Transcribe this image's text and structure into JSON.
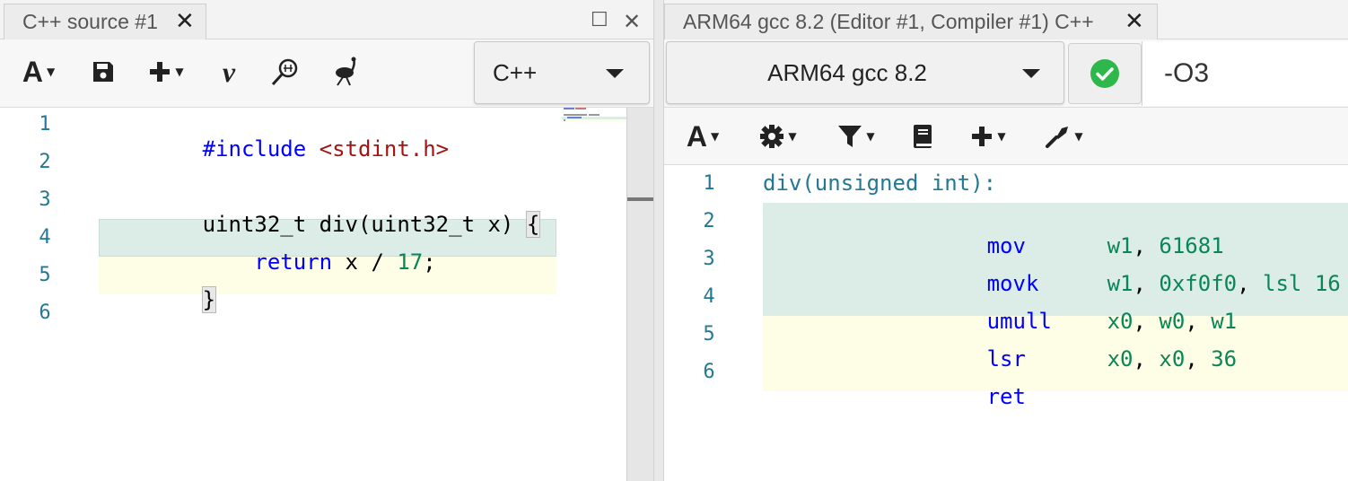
{
  "left_pane": {
    "tab_title": "C++ source #1",
    "language": "C++",
    "toolbar_icons": [
      "font-size-icon",
      "save-icon",
      "add-icon",
      "vim-icon",
      "search-icon",
      "ostrich-icon"
    ],
    "line_numbers": [
      "1",
      "2",
      "3",
      "4",
      "5",
      "6"
    ],
    "code": {
      "line1_directive": "#include",
      "line1_header": "<stdint.h>",
      "line3_text": "uint32_t div(uint32_t x) ",
      "line3_brace": "{",
      "line4_keyword": "return",
      "line4_expr": " x / ",
      "line4_number": "17",
      "line4_semicolon": ";",
      "line5_brace": "}"
    }
  },
  "right_pane": {
    "tab_title": "ARM64 gcc 8.2 (Editor #1, Compiler #1) C++",
    "compiler_name": "ARM64 gcc 8.2",
    "compiler_flags": "-O3",
    "status": "compiled-ok",
    "toolbar_icons": [
      "font-size-icon",
      "settings-icon",
      "filter-icon",
      "book-icon",
      "add-icon",
      "tools-icon"
    ],
    "line_numbers": [
      "1",
      "2",
      "3",
      "4",
      "5",
      "6"
    ],
    "asm": {
      "label": "div(unsigned int):",
      "l2_mn": "mov",
      "l2_op1": "w1",
      "l2_sep": ", ",
      "l2_op2": "61681",
      "l3_mn": "movk",
      "l3_op1": "w1",
      "l3_sep1": ", ",
      "l3_op2": "0xf0f0",
      "l3_sep2": ", ",
      "l3_op3": "lsl",
      "l3_sp": " ",
      "l3_op4": "16",
      "l4_mn": "umull",
      "l4_op1": "x0",
      "l4_sep1": ", ",
      "l4_op2": "w0",
      "l4_sep2": ", ",
      "l4_op3": "w1",
      "l5_mn": "lsr",
      "l5_op1": "x0",
      "l5_sep1": ", ",
      "l5_op2": "x0",
      "l5_sep2": ", ",
      "l5_op3": "36",
      "l6_mn": "ret"
    }
  },
  "colors": {
    "highlight_green": "#dcede8",
    "highlight_yellow": "#fefde5",
    "keyword_blue": "#0000ff",
    "string_red": "#a31515",
    "number_green": "#098658",
    "line_number": "#237893",
    "ok_green": "#2eb84b"
  }
}
